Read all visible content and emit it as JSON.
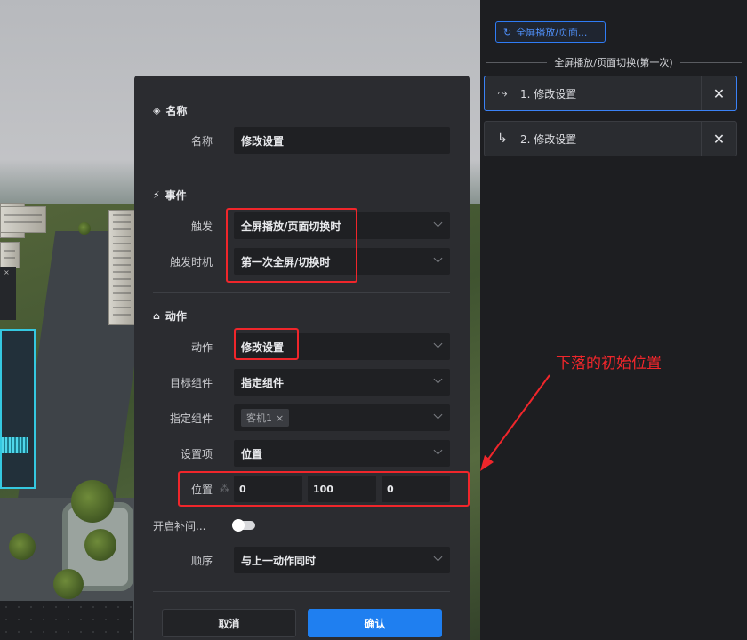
{
  "sidebar": {
    "trigger_button": "全屏播放/页面...",
    "group_title": "全屏播放/页面切换(第一次)",
    "actions": [
      {
        "label": "1. 修改设置",
        "selected": true
      },
      {
        "label": "2. 修改设置",
        "selected": false
      }
    ]
  },
  "modal": {
    "name_section": {
      "title": "名称",
      "name_label": "名称",
      "name_value": "修改设置"
    },
    "event_section": {
      "title": "事件",
      "trigger_label": "触发",
      "trigger_value": "全屏播放/页面切换时",
      "timing_label": "触发时机",
      "timing_value": "第一次全屏/切换时"
    },
    "action_section": {
      "title": "动作",
      "action_label": "动作",
      "action_value": "修改设置",
      "target_label": "目标组件",
      "target_value": "指定组件",
      "specified_label": "指定组件",
      "specified_tag": "客机1",
      "setting_label": "设置项",
      "setting_value": "位置",
      "position_label": "位置",
      "position_x": "0",
      "position_y": "100",
      "position_z": "0",
      "tween_label": "开启补间...",
      "tween_on": false,
      "order_label": "顺序",
      "order_value": "与上一动作同时"
    },
    "cancel_label": "取消",
    "confirm_label": "确认"
  },
  "annotation": {
    "text": "下落的初始位置",
    "color": "#f0262b"
  },
  "colors": {
    "accent": "#1f7ff0",
    "highlight": "#f0262b"
  }
}
